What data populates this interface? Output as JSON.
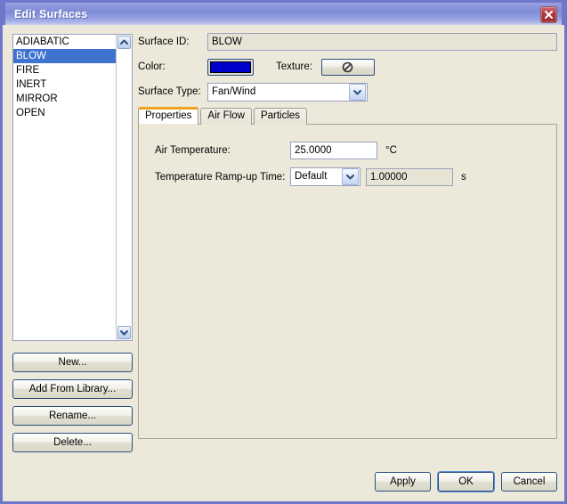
{
  "window": {
    "title": "Edit Surfaces",
    "close_icon": "close-icon",
    "border_color": "#6f77cb",
    "titlebar_color": "#8e98dc",
    "background_color": "#ece9da"
  },
  "surface_list": {
    "items": [
      {
        "label": "ADIABATIC",
        "selected": false
      },
      {
        "label": "BLOW",
        "selected": true
      },
      {
        "label": "FIRE",
        "selected": false
      },
      {
        "label": "INERT",
        "selected": false
      },
      {
        "label": "MIRROR",
        "selected": false
      },
      {
        "label": "OPEN",
        "selected": false
      }
    ],
    "selection_color": "#3f73d0",
    "scroll_up_icon": "chevron-up-icon",
    "scroll_down_icon": "chevron-down-icon"
  },
  "left_buttons": {
    "new": "New...",
    "add_from_library": "Add From Library...",
    "rename": "Rename...",
    "delete": "Delete..."
  },
  "form": {
    "surface_id_label": "Surface ID:",
    "surface_id_value": "BLOW",
    "color_label": "Color:",
    "color_value": "#0000cc",
    "texture_label": "Texture:",
    "texture_icon": "no-texture-icon",
    "surface_type_label": "Surface Type:",
    "surface_type_value": "Fan/Wind",
    "surface_type_arrow_icon": "chevron-down-icon"
  },
  "tabs": [
    {
      "label": "Properties",
      "active": true
    },
    {
      "label": "Air Flow",
      "active": false
    },
    {
      "label": "Particles",
      "active": false
    }
  ],
  "tab_accent_color": "#f0a31e",
  "properties": {
    "air_temperature_label": "Air Temperature:",
    "air_temperature_value": "25.0000",
    "air_temperature_unit": "°C",
    "ramp_label": "Temperature Ramp-up Time:",
    "ramp_mode_value": "Default",
    "ramp_mode_arrow_icon": "chevron-down-icon",
    "ramp_value": "1.00000",
    "ramp_unit": "s"
  },
  "dialog_buttons": {
    "apply": "Apply",
    "ok": "OK",
    "cancel": "Cancel"
  }
}
